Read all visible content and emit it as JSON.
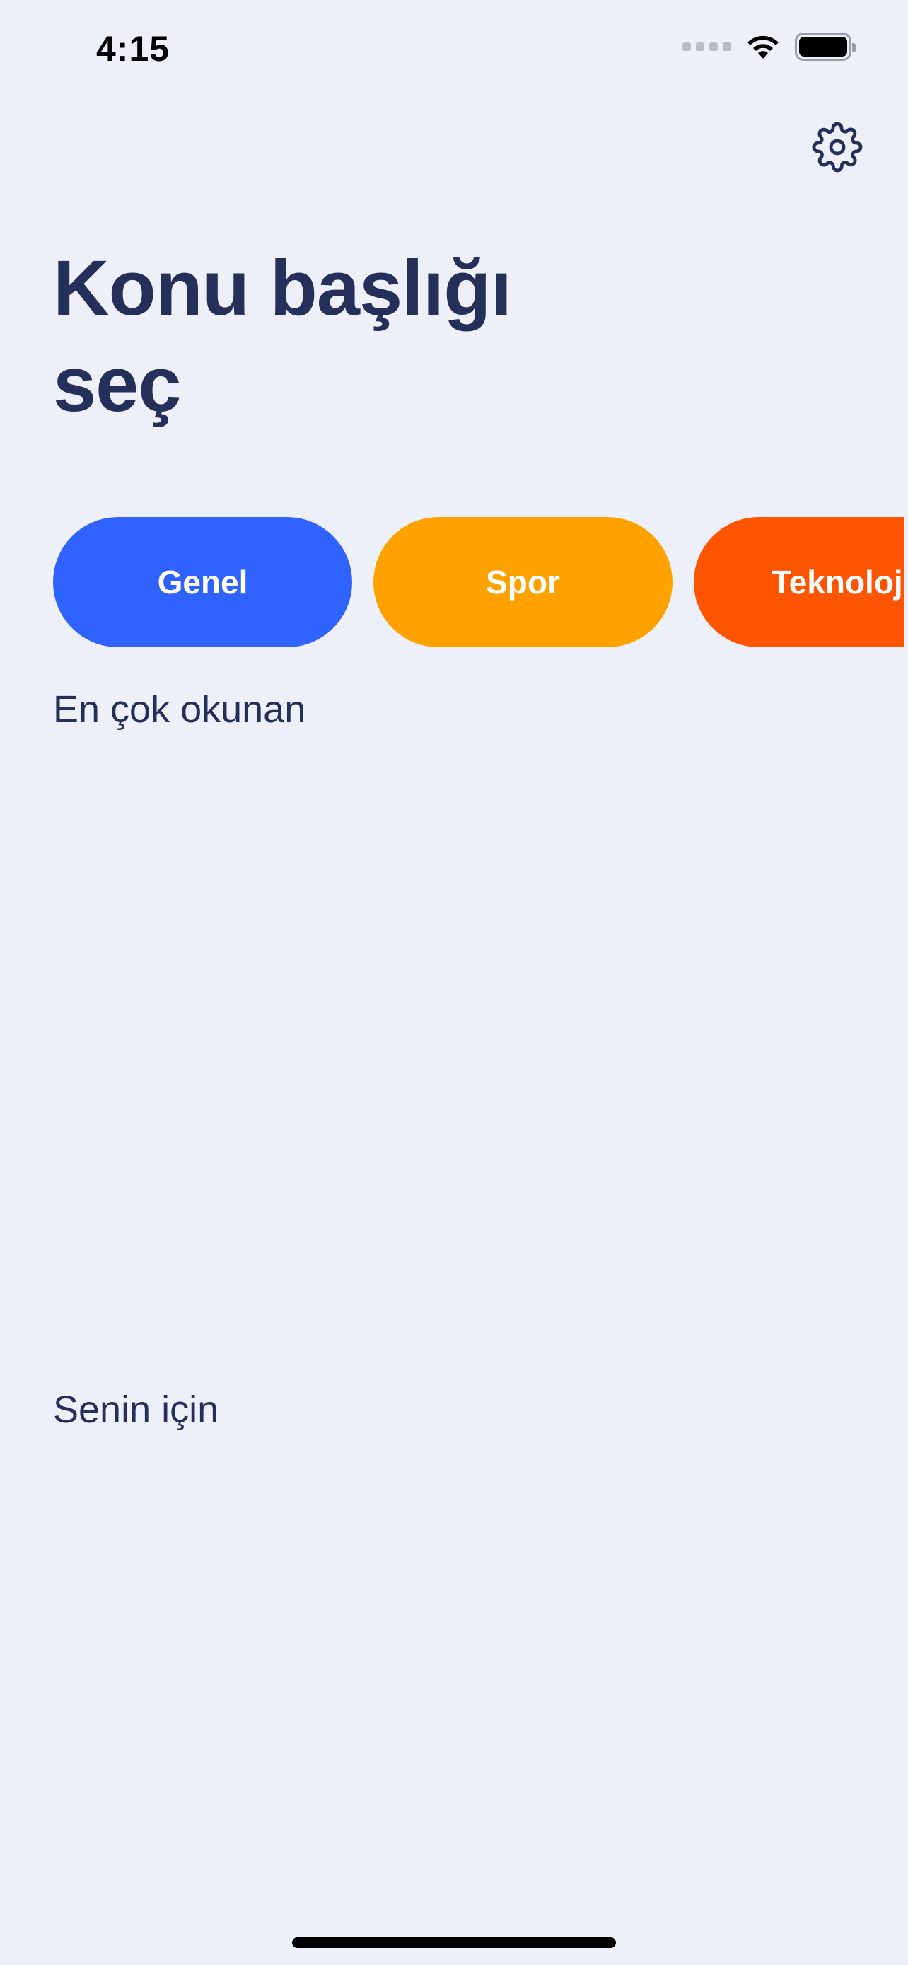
{
  "status_bar": {
    "time": "4:15",
    "signal_icon": "signal-icon",
    "wifi_icon": "wifi-icon",
    "battery_icon": "battery-icon"
  },
  "header": {
    "settings_icon": "gear-icon",
    "title_line1": "Konu başlığı",
    "title_line2": "seç"
  },
  "categories": [
    {
      "label": "Genel",
      "color": "#2F62FF"
    },
    {
      "label": "Spor",
      "color": "#FFA200"
    },
    {
      "label": "Teknoloji",
      "color": "#FF5500"
    }
  ],
  "sections": {
    "popular": "En çok okunan",
    "for_you": "Senin için"
  },
  "colors": {
    "background": "#EEF0F9",
    "text_primary": "#252F5A"
  }
}
